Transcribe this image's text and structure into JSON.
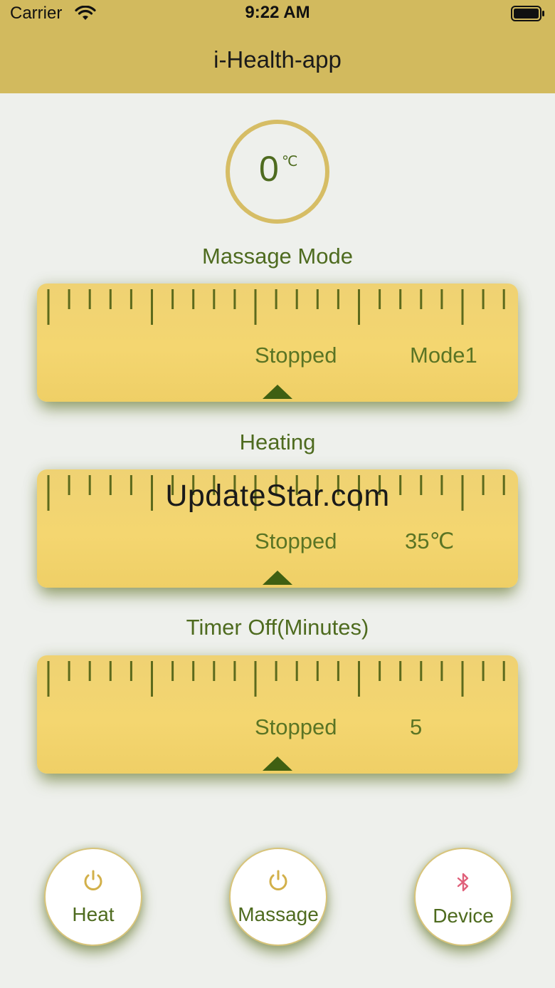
{
  "status_bar": {
    "carrier": "Carrier",
    "time": "9:22 AM"
  },
  "header": {
    "title": "i-Health-app"
  },
  "temperature": {
    "value": "0",
    "unit": "℃"
  },
  "sections": [
    {
      "label": "Massage Mode",
      "status": "Stopped",
      "value": "Mode1"
    },
    {
      "label": "Heating",
      "status": "Stopped",
      "value": "35℃"
    },
    {
      "label": "Timer Off(Minutes)",
      "status": "Stopped",
      "value": "5"
    }
  ],
  "watermark": "UpdateStar.com",
  "buttons": [
    {
      "label": "Heat",
      "icon": "power-icon"
    },
    {
      "label": "Massage",
      "icon": "power-icon"
    },
    {
      "label": "Device",
      "icon": "bluetooth-icon"
    }
  ],
  "colors": {
    "header": "#d2ba5e",
    "accent_green": "#4e6b1f",
    "ruler": "#f4d670",
    "background": "#eef0ec",
    "bluetooth": "#e0607a"
  }
}
